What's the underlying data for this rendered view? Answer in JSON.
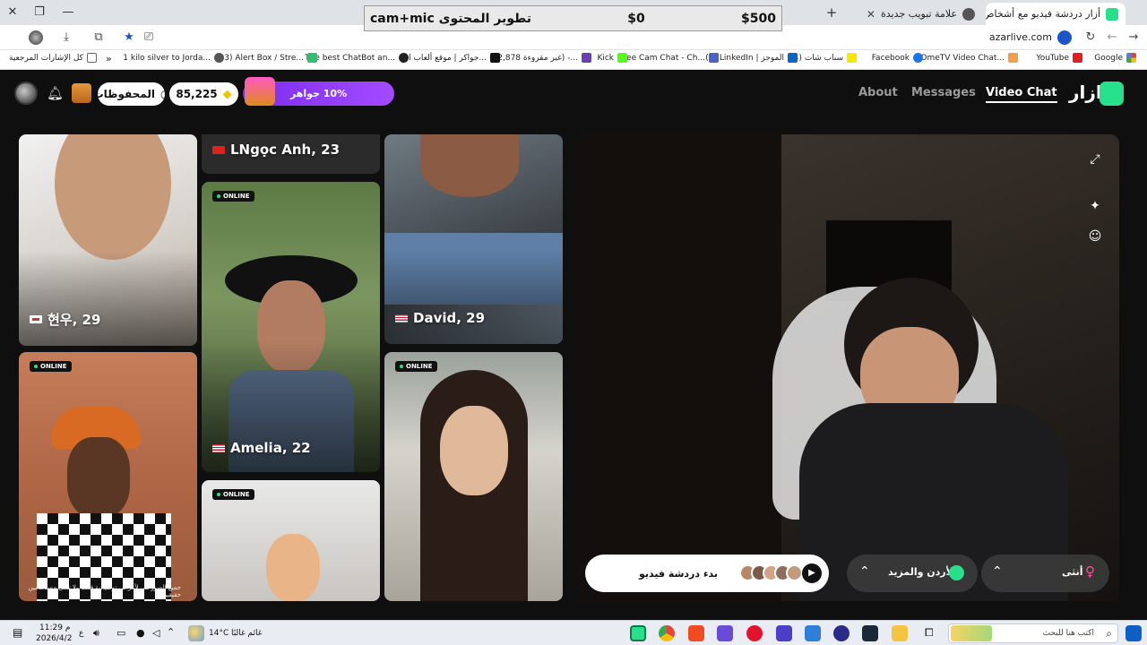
{
  "tabs": [
    {
      "title": "أزار دردشة فيديو مع أشخاص",
      "active": true
    },
    {
      "title": "علامة تبويب جديدة",
      "active": false
    }
  ],
  "overlay_banner": {
    "left_text": "تطوير المحتوى cam+mic",
    "middle_text": "$0",
    "right_text": "$500"
  },
  "address": {
    "url": "azarlive.com"
  },
  "bookmarks": [
    {
      "label": "Google",
      "color": "#ffffff"
    },
    {
      "label": "YouTube",
      "color": "#e11d1d"
    },
    {
      "label": "OmeTV Video Chat...",
      "color": "#f0a04b"
    },
    {
      "label": "Facebook",
      "color": "#1877f2"
    },
    {
      "label": "(4) سناب شات",
      "color": "#f7e600"
    },
    {
      "label": "(1) LinkedIn | الموجز",
      "color": "#0a66c2"
    },
    {
      "label": "Free Cam Chat - Ch...",
      "color": "#4a63c7"
    },
    {
      "label": "Kick",
      "color": "#53fc18"
    },
    {
      "label": "(22,878 غير مقروءة) -...",
      "color": "#6a3fb5"
    },
    {
      "label": "جواكر | موقع ألعاب ا...",
      "color": "#111111"
    },
    {
      "label": "The best ChatBot an...",
      "color": "#222222"
    },
    {
      "label": "(33) Alert Box / Stre...",
      "color": "#2fbf71"
    },
    {
      "label": "1 kilo silver to Jorda...",
      "color": "#555555"
    },
    {
      "label": "كل الإشارات المرجعية",
      "color": "#666666"
    }
  ],
  "header": {
    "saved_label": "المحفوظات",
    "coins": "85,225",
    "promo_label": "10% جواهر",
    "nav": [
      "About",
      "Messages",
      "Video Chat"
    ],
    "active_nav": "Video Chat",
    "logo_text": "ازار"
  },
  "online_label": "ONLINE",
  "grid": [
    {
      "name": "현우, 29",
      "online": false
    },
    {
      "name": "LNgọc Anh, 23",
      "online": false
    },
    {
      "name": "David, 29",
      "online": false
    },
    {
      "name": "Amelia, 22",
      "online": true
    },
    {
      "name": "",
      "online": true
    },
    {
      "name": "",
      "online": true
    },
    {
      "name": "",
      "online": true
    }
  ],
  "disclaimer": "جميع الصور هي لأغراض توضيحية فقط ولا تمثل مستخدمين حقيقيين",
  "controls": {
    "start_label": "بدء دردشة فيديو",
    "region_label": "الأردن والمزيد",
    "gender_label": "أنثى"
  },
  "taskbar": {
    "search_placeholder": "اكتب هنا للبحث",
    "weather_temp": "14°C",
    "weather_text": "غائم غالبًا",
    "time": "11:29 م",
    "date": "2026/4/2",
    "lang": "ع"
  },
  "colors": {
    "accent_green": "#27e08b",
    "promo_purple": "#8a35f5"
  }
}
